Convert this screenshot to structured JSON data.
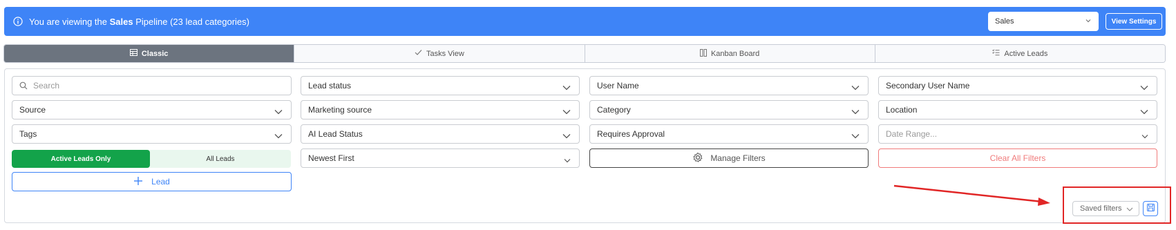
{
  "banner": {
    "prefix": "You are viewing the ",
    "pipeline_name": "Sales",
    "suffix": " Pipeline (23 lead categories)",
    "pipeline_select_value": "Sales",
    "view_settings_label": "View Settings",
    "color": "#3e84f7"
  },
  "tabs": [
    {
      "label": "Classic",
      "icon": "table-icon",
      "active": true
    },
    {
      "label": "Tasks View",
      "icon": "check-icon",
      "active": false
    },
    {
      "label": "Kanban Board",
      "icon": "columns-icon",
      "active": false
    },
    {
      "label": "Active Leads",
      "icon": "list-check-icon",
      "active": false
    }
  ],
  "filters": {
    "search_placeholder": "Search",
    "lead_status": "Lead status",
    "user_name": "User Name",
    "secondary_user_name": "Secondary User Name",
    "source": "Source",
    "marketing_source": "Marketing source",
    "category": "Category",
    "location": "Location",
    "tags": "Tags",
    "ai_lead_status": "AI Lead Status",
    "requires_approval": "Requires Approval",
    "date_range_placeholder": "Date Range...",
    "sort_order": "Newest First",
    "active_leads_only": "Active Leads Only",
    "all_leads": "All Leads",
    "add_lead": "Lead",
    "manage_filters": "Manage Filters",
    "clear_all_filters": "Clear All Filters"
  },
  "saved_filters": {
    "label": "Saved filters"
  },
  "colors": {
    "active_green": "#13a34a",
    "danger": "#f07b7b",
    "annotation_red": "#e12626",
    "active_tab": "#6c747f"
  }
}
